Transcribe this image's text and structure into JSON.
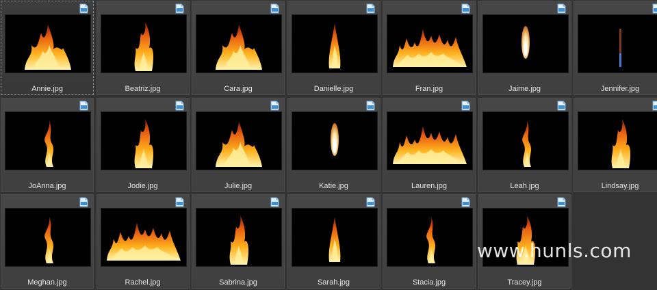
{
  "files": [
    {
      "name": "Annie.jpg",
      "flame": "wide",
      "selected": true
    },
    {
      "name": "Beatriz.jpg",
      "flame": "tall"
    },
    {
      "name": "Cara.jpg",
      "flame": "wide"
    },
    {
      "name": "Danielle.jpg",
      "flame": "thin"
    },
    {
      "name": "Fran.jpg",
      "flame": "wall"
    },
    {
      "name": "Jaime.jpg",
      "flame": "candle"
    },
    {
      "name": "Jennifer.jpg",
      "flame": "blue"
    },
    {
      "name": "JoAnna.jpg",
      "flame": "wisp"
    },
    {
      "name": "Jodie.jpg",
      "flame": "tall"
    },
    {
      "name": "Julie.jpg",
      "flame": "wide"
    },
    {
      "name": "Katie.jpg",
      "flame": "candle"
    },
    {
      "name": "Lauren.jpg",
      "flame": "wall"
    },
    {
      "name": "Leah.jpg",
      "flame": "wisp"
    },
    {
      "name": "Lindsay.jpg",
      "flame": "tall"
    },
    {
      "name": "Meghan.jpg",
      "flame": "wisp"
    },
    {
      "name": "Rachel.jpg",
      "flame": "wall"
    },
    {
      "name": "Sabrina.jpg",
      "flame": "tall"
    },
    {
      "name": "Sarah.jpg",
      "flame": "thin"
    },
    {
      "name": "Stacia.jpg",
      "flame": "wisp"
    },
    {
      "name": "Tracey.jpg",
      "flame": "tall"
    }
  ],
  "badge_icon": "jpg-file-icon",
  "watermark": "www.hunls.com",
  "colors": {
    "background": "#333333",
    "tile": "#444444",
    "flame_core": "#fff2a8",
    "flame_mid": "#ffb21c",
    "flame_outer": "#d9480f",
    "blue_flame": "#4d7bd6"
  }
}
